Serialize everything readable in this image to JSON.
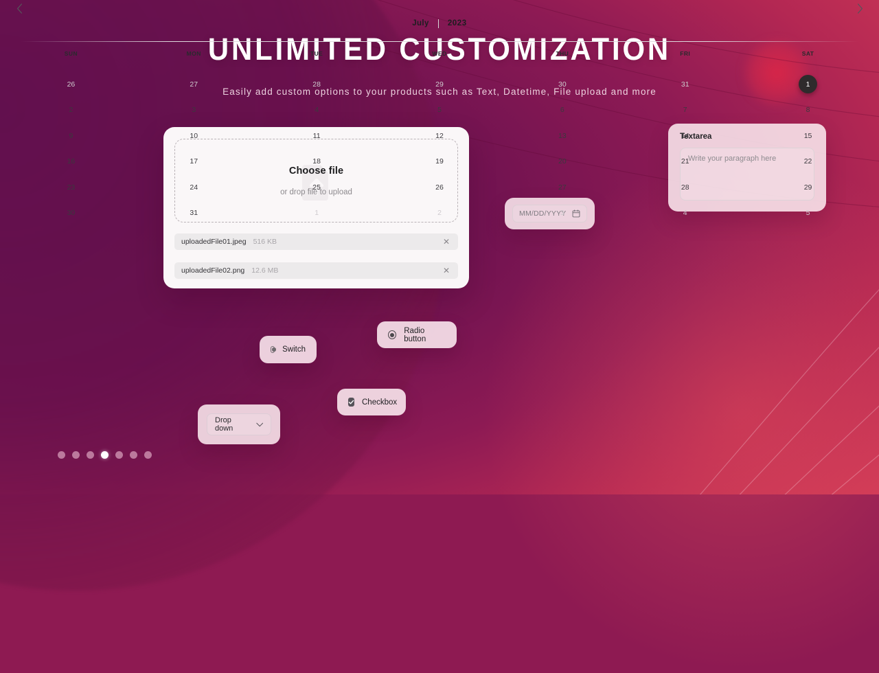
{
  "hero": {
    "title": "UNLIMITED CUSTOMIZATION",
    "subtitle": "Easily add custom options to your products such as Text, Datetime, File upload and more"
  },
  "upload": {
    "dropzone_title": "Choose file",
    "dropzone_hint": "or drop file to upload",
    "watermark_icon": "file-upload-icon",
    "files": [
      {
        "name": "uploadedFile01.jpeg",
        "size": "516 KB",
        "remove_icon": "close-icon"
      },
      {
        "name": "uploadedFile02.png",
        "size": "12.6 MB",
        "remove_icon": "close-icon"
      }
    ]
  },
  "textarea": {
    "label": "Textarea",
    "placeholder": "Write your paragraph here",
    "value": ""
  },
  "date_field": {
    "placeholder": "MM/DD/YYYY",
    "value": "",
    "icon": "calendar-icon"
  },
  "calendar": {
    "prev_icon": "chevron-left-icon",
    "next_icon": "chevron-right-icon",
    "month": "July",
    "year": "2023",
    "divider": "|",
    "weekdays": [
      "SUN",
      "MON",
      "TUE",
      "WED",
      "THU",
      "FRI",
      "SAT"
    ],
    "selected_day": "1",
    "weeks": [
      [
        {
          "d": "26",
          "state": "muted"
        },
        {
          "d": "27",
          "state": "muted"
        },
        {
          "d": "28",
          "state": "muted"
        },
        {
          "d": "29",
          "state": "muted"
        },
        {
          "d": "30",
          "state": "muted"
        },
        {
          "d": "31",
          "state": "muted"
        },
        {
          "d": "1",
          "state": "selected"
        }
      ],
      [
        {
          "d": "2",
          "state": "normal"
        },
        {
          "d": "3",
          "state": "normal"
        },
        {
          "d": "4",
          "state": "normal"
        },
        {
          "d": "5",
          "state": "normal"
        },
        {
          "d": "6",
          "state": "normal"
        },
        {
          "d": "7",
          "state": "normal"
        },
        {
          "d": "8",
          "state": "normal"
        }
      ],
      [
        {
          "d": "9",
          "state": "normal"
        },
        {
          "d": "10",
          "state": "normal"
        },
        {
          "d": "11",
          "state": "normal"
        },
        {
          "d": "12",
          "state": "normal"
        },
        {
          "d": "13",
          "state": "normal"
        },
        {
          "d": "14",
          "state": "normal"
        },
        {
          "d": "15",
          "state": "normal"
        }
      ],
      [
        {
          "d": "16",
          "state": "normal"
        },
        {
          "d": "17",
          "state": "normal"
        },
        {
          "d": "18",
          "state": "normal"
        },
        {
          "d": "19",
          "state": "normal"
        },
        {
          "d": "20",
          "state": "normal"
        },
        {
          "d": "21",
          "state": "normal"
        },
        {
          "d": "22",
          "state": "normal"
        }
      ],
      [
        {
          "d": "23",
          "state": "normal"
        },
        {
          "d": "24",
          "state": "normal"
        },
        {
          "d": "25",
          "state": "normal"
        },
        {
          "d": "26",
          "state": "normal"
        },
        {
          "d": "27",
          "state": "normal"
        },
        {
          "d": "28",
          "state": "normal"
        },
        {
          "d": "29",
          "state": "normal"
        }
      ],
      [
        {
          "d": "30",
          "state": "normal"
        },
        {
          "d": "31",
          "state": "normal"
        },
        {
          "d": "1",
          "state": "muted"
        },
        {
          "d": "2",
          "state": "muted"
        },
        {
          "d": "3",
          "state": "muted"
        },
        {
          "d": "4",
          "state": "muted"
        },
        {
          "d": "5",
          "state": "muted"
        }
      ]
    ]
  },
  "controls": {
    "switch": {
      "label": "Switch",
      "state": "off",
      "icon": "toggle-switch-icon"
    },
    "radio": {
      "label": "Radio button",
      "state": "selected",
      "icon": "radio-selected-icon"
    },
    "checkbox": {
      "label": "Checkbox",
      "state": "checked",
      "icon": "checkbox-checked-icon"
    },
    "dropdown": {
      "label": "Drop down",
      "icon": "chevron-down-icon"
    }
  },
  "carousel": {
    "total": 7,
    "active_index": 3
  },
  "colors": {
    "bg_deep_purple": "#5c0f4a",
    "bg_magenta": "#8d1a54",
    "bg_red": "#e04a5c",
    "card_white": "#faf7f8",
    "card_tint": "#fae8ee",
    "selected_day": "#2e2b2c",
    "text_dark": "#1c1c1e",
    "text_muted": "#8d8a8e"
  }
}
